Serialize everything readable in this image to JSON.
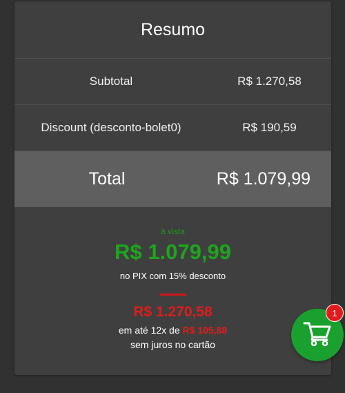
{
  "summary": {
    "title": "Resumo",
    "subtotal_label": "Subtotal",
    "subtotal_value": "R$ 1.270,58",
    "discount_label": "Discount (desconto-bolet0)",
    "discount_value": "R$ 190,59",
    "total_label": "Total",
    "total_value": "R$ 1.079,99"
  },
  "payment": {
    "pix_caption": "à vista",
    "pix_price": "R$ 1.079,99",
    "pix_note": "no PIX com 15% desconto",
    "card_price": "R$ 1.270,58",
    "installments_prefix": "em até 12x de",
    "installment_value": "R$ 105,88",
    "no_interest_note": "sem juros no cartão"
  },
  "cart": {
    "icon": "cart-icon",
    "badge_count": "1",
    "button_color": "#1aa02e",
    "badge_color": "#e11b1b"
  },
  "colors": {
    "green_price": "#1ea41e",
    "red_price": "#e01c1c"
  }
}
